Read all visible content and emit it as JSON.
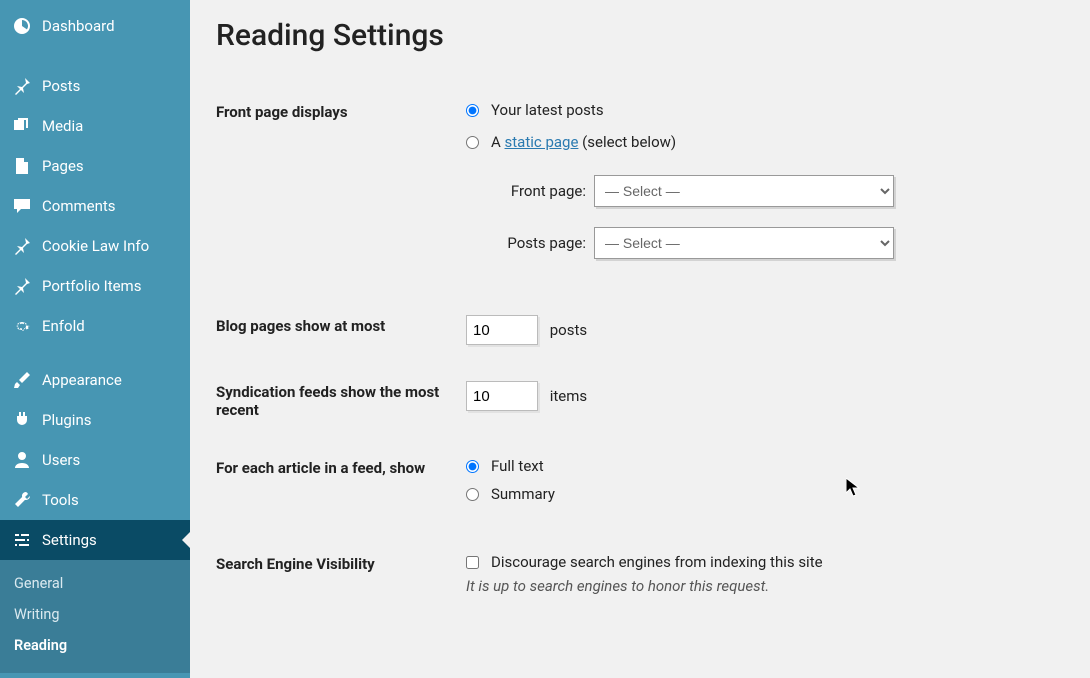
{
  "sidebar": {
    "items": [
      {
        "label": "Dashboard"
      },
      {
        "label": "Posts"
      },
      {
        "label": "Media"
      },
      {
        "label": "Pages"
      },
      {
        "label": "Comments"
      },
      {
        "label": "Cookie Law Info"
      },
      {
        "label": "Portfolio Items"
      },
      {
        "label": "Enfold"
      },
      {
        "label": "Appearance"
      },
      {
        "label": "Plugins"
      },
      {
        "label": "Users"
      },
      {
        "label": "Tools"
      },
      {
        "label": "Settings"
      }
    ],
    "submenu": [
      {
        "label": "General"
      },
      {
        "label": "Writing"
      },
      {
        "label": "Reading"
      }
    ]
  },
  "page": {
    "title": "Reading Settings"
  },
  "front_page": {
    "row_label": "Front page displays",
    "option_latest": "Your latest posts",
    "option_static_prefix": "A ",
    "option_static_link": "static page",
    "option_static_suffix": " (select below)",
    "front_label": "Front page:",
    "posts_label": "Posts page:",
    "select_placeholder": "— Select —"
  },
  "blog_pages": {
    "row_label": "Blog pages show at most",
    "value": "10",
    "unit": "posts"
  },
  "syndication": {
    "row_label": "Syndication feeds show the most recent",
    "value": "10",
    "unit": "items"
  },
  "article_feed": {
    "row_label": "For each article in a feed, show",
    "option_full": "Full text",
    "option_summary": "Summary"
  },
  "search_engine": {
    "row_label": "Search Engine Visibility",
    "checkbox_label": "Discourage search engines from indexing this site",
    "hint": "It is up to search engines to honor this request."
  }
}
